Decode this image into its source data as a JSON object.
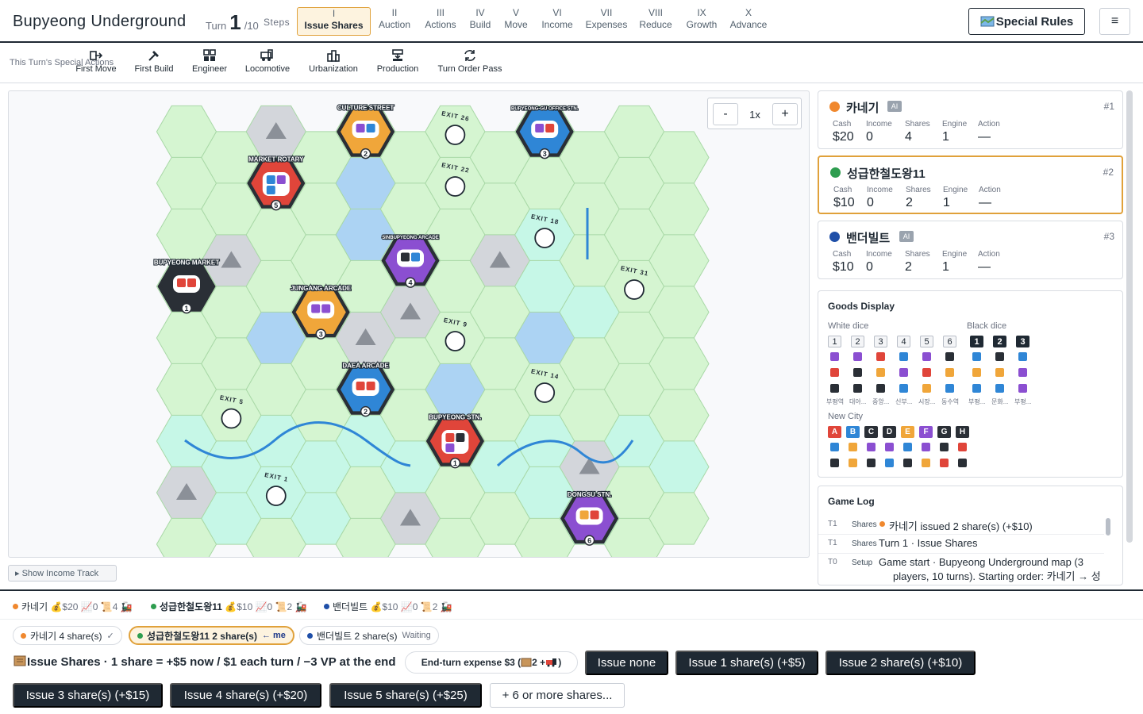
{
  "header": {
    "title": "Bupyeong Underground",
    "turn_label": "Turn",
    "turn_number": "1",
    "turn_total": "/10",
    "steps_label": "Steps",
    "steps": [
      {
        "roman": "I",
        "name": "Issue Shares",
        "active": true
      },
      {
        "roman": "II",
        "name": "Auction"
      },
      {
        "roman": "III",
        "name": "Actions"
      },
      {
        "roman": "IV",
        "name": "Build"
      },
      {
        "roman": "V",
        "name": "Move"
      },
      {
        "roman": "VI",
        "name": "Income"
      },
      {
        "roman": "VII",
        "name": "Expenses"
      },
      {
        "roman": "VIII",
        "name": "Reduce"
      },
      {
        "roman": "IX",
        "name": "Growth"
      },
      {
        "roman": "X",
        "name": "Advance"
      }
    ],
    "special_rules_label": "Special Rules",
    "special_rules_icon": "map-icon",
    "menu_icon": "hamburger-icon",
    "menu_glyph": "≡"
  },
  "special_actions": {
    "label": "This Turn's Special Actions",
    "items": [
      {
        "label": "First Move",
        "icon": "move-arrow-icon"
      },
      {
        "label": "First Build",
        "icon": "hammer-icon"
      },
      {
        "label": "Engineer",
        "icon": "grid-icon"
      },
      {
        "label": "Locomotive",
        "icon": "locomotive-icon"
      },
      {
        "label": "Urbanization",
        "icon": "buildings-icon"
      },
      {
        "label": "Production",
        "icon": "production-icon"
      },
      {
        "label": "Turn Order Pass",
        "icon": "refresh-icon"
      }
    ]
  },
  "board": {
    "zoom_minus": "-",
    "zoom_level": "1x",
    "zoom_plus": "+",
    "show_income_track": "▸ Show Income Track",
    "cities": [
      {
        "name": "CULTURE STREET",
        "number": "2",
        "color": "#f0a63a",
        "cubes": [
          "#8b4fd1",
          "#2f86d6"
        ]
      },
      {
        "name": "BUPYEONG-GU OFFICE STN.",
        "number": "3",
        "color": "#2f86d6",
        "cubes": [
          "#8b4fd1",
          "#e0453a"
        ]
      },
      {
        "name": "MARKET ROTARY",
        "number": "5",
        "color": "#e0453a",
        "cubes": [
          "#2f86d6",
          "#8b4fd1",
          "#2f86d6"
        ]
      },
      {
        "name": "SINBUPYEONG ARCADE",
        "number": "4",
        "color": "#8b4fd1",
        "cubes": [
          "#2a2f36",
          "#2f86d6"
        ]
      },
      {
        "name": "BUPYEONG MARKET",
        "number": "1",
        "color": "#2a2f36",
        "cubes": [
          "#e0453a",
          "#e0453a"
        ]
      },
      {
        "name": "JUNGANG ARCADE",
        "number": "3",
        "color": "#f0a63a",
        "cubes": [
          "#8b4fd1",
          "#8b4fd1"
        ]
      },
      {
        "name": "DAEA ARCADE",
        "number": "2",
        "color": "#2f86d6",
        "cubes": [
          "#e0453a",
          "#e0453a"
        ]
      },
      {
        "name": "BUPYEONG STN.",
        "number": "1",
        "color": "#e0453a",
        "cubes": [
          "#e0453a",
          "#2a2f36",
          "#8b4fd1"
        ]
      },
      {
        "name": "DONGSU STN.",
        "number": "6",
        "color": "#8b4fd1",
        "cubes": [
          "#f0a63a",
          "#e0453a"
        ]
      }
    ],
    "exits": [
      "EXIT 26",
      "EXIT 22",
      "EXIT 18",
      "EXIT 31",
      "EXIT 9",
      "EXIT 14",
      "EXIT 5",
      "EXIT 1"
    ]
  },
  "players": [
    {
      "name": "카네기",
      "ai": "AI",
      "rank": "#1",
      "color": "#f0882e",
      "cash": "$20",
      "income": "0",
      "shares": "4",
      "engine": "1",
      "action": "—",
      "active": false
    },
    {
      "name": "성급한철도왕11",
      "ai": "",
      "rank": "#2",
      "color": "#2e9d4f",
      "cash": "$10",
      "income": "0",
      "shares": "2",
      "engine": "1",
      "action": "—",
      "active": true
    },
    {
      "name": "밴더빌트",
      "ai": "AI",
      "rank": "#3",
      "color": "#1f4fa8",
      "cash": "$10",
      "income": "0",
      "shares": "2",
      "engine": "1",
      "action": "—",
      "active": false
    }
  ],
  "stat_labels": {
    "cash": "Cash",
    "income": "Income",
    "shares": "Shares",
    "engine": "Engine",
    "action": "Action"
  },
  "goods": {
    "title": "Goods Display",
    "white_label": "White dice",
    "black_label": "Black dice",
    "new_city_label": "New City",
    "white_columns": [
      {
        "die": "1",
        "cubes": [
          "#8b4fd1",
          "#e0453a",
          "#2a2f36"
        ],
        "caption": "부평역"
      },
      {
        "die": "2",
        "cubes": [
          "#8b4fd1",
          "#2a2f36",
          "#2a2f36"
        ],
        "caption": "대아..."
      },
      {
        "die": "3",
        "cubes": [
          "#e0453a",
          "#f0a63a",
          "#2a2f36"
        ],
        "caption": "중앙..."
      },
      {
        "die": "4",
        "cubes": [
          "#2f86d6",
          "#8b4fd1",
          "#2f86d6"
        ],
        "caption": "신부..."
      },
      {
        "die": "5",
        "cubes": [
          "#8b4fd1",
          "#e0453a",
          "#f0a63a"
        ],
        "caption": "시장..."
      },
      {
        "die": "6",
        "cubes": [
          "#2a2f36",
          "#f0a63a",
          "#2f86d6"
        ],
        "caption": "동수역"
      }
    ],
    "black_columns": [
      {
        "die": "1",
        "cubes": [
          "#2f86d6",
          "#f0a63a",
          "#2f86d6"
        ],
        "caption": "부평..."
      },
      {
        "die": "2",
        "cubes": [
          "#2a2f36",
          "#f0a63a",
          "#2f86d6"
        ],
        "caption": "문화..."
      },
      {
        "die": "3",
        "cubes": [
          "#2f86d6",
          "#8b4fd1",
          "#8b4fd1"
        ],
        "caption": "부평..."
      }
    ],
    "new_city_columns": [
      {
        "letter": "A",
        "color": "#e0453a",
        "cubes": [
          "#2f86d6",
          "#2a2f36"
        ]
      },
      {
        "letter": "B",
        "color": "#2f86d6",
        "cubes": [
          "#f0a63a",
          "#f0a63a"
        ]
      },
      {
        "letter": "C",
        "color": "#2a2f36",
        "cubes": [
          "#8b4fd1",
          "#2a2f36"
        ]
      },
      {
        "letter": "D",
        "color": "#2a2f36",
        "cubes": [
          "#8b4fd1",
          "#2f86d6"
        ]
      },
      {
        "letter": "E",
        "color": "#f0a63a",
        "cubes": [
          "#2f86d6",
          "#2a2f36"
        ]
      },
      {
        "letter": "F",
        "color": "#8b4fd1",
        "cubes": [
          "#8b4fd1",
          "#f0a63a"
        ]
      },
      {
        "letter": "G",
        "color": "#2a2f36",
        "cubes": [
          "#2a2f36",
          "#e0453a"
        ]
      },
      {
        "letter": "H",
        "color": "#2a2f36",
        "cubes": [
          "#e0453a",
          "#2a2f36"
        ]
      }
    ]
  },
  "log": {
    "title": "Game Log",
    "entries": [
      {
        "turn": "T1",
        "cat": "Shares",
        "msg": "카네기 issued 2 share(s) (+$10)",
        "dot": "#f0882e"
      },
      {
        "turn": "T1",
        "cat": "Shares",
        "msg": "Turn 1 · Issue Shares",
        "dot": ""
      },
      {
        "turn": "T0",
        "cat": "Setup",
        "msg": "Game start · Bupyeong Underground map (3",
        "msg2": "players, 10 turns). Starting order: 카네기 → 성",
        "dot": ""
      }
    ]
  },
  "summary": [
    {
      "name": "카네기",
      "color": "#f0882e",
      "cash": "$20",
      "income": "0",
      "shares": "4",
      "bold": false
    },
    {
      "name": "성급한철도왕11",
      "color": "#2e9d4f",
      "cash": "$10",
      "income": "0",
      "shares": "2",
      "bold": true
    },
    {
      "name": "밴더빌트",
      "color": "#1f4fa8",
      "cash": "$10",
      "income": "0",
      "shares": "2",
      "bold": false
    }
  ],
  "status_pills": [
    {
      "text": "카네기 4 share(s)",
      "status": "✓",
      "color": "#f0882e"
    },
    {
      "text": "성급한철도왕11 2 share(s)",
      "status": "← me",
      "color": "#2e9d4f"
    },
    {
      "text": "밴더빌트 2 share(s)",
      "status": "Waiting",
      "color": "#1f4fa8"
    }
  ],
  "issue": {
    "prompt": "Issue Shares · 1 share = +$5 now / $1 each turn / −3 VP at the end",
    "expense": "End-turn expense $3 (",
    "expense_mid": "2 + ",
    "expense_end": ")",
    "buttons": [
      "Issue none",
      "Issue 1 share(s) (+$5)",
      "Issue 2 share(s) (+$10)",
      "Issue 3 share(s) (+$15)",
      "Issue 4 share(s) (+$20)",
      "Issue 5 share(s) (+$25)",
      "+ 6 or more shares..."
    ]
  }
}
